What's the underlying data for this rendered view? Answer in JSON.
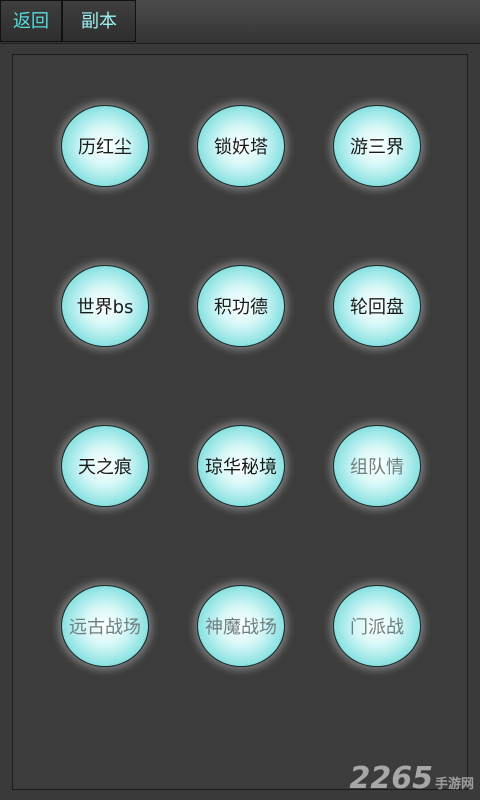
{
  "topbar": {
    "back_label": "返回",
    "dungeon_label": "副本"
  },
  "buttons": [
    {
      "label": "历红尘",
      "enabled": true
    },
    {
      "label": "锁妖塔",
      "enabled": true
    },
    {
      "label": "游三界",
      "enabled": true
    },
    {
      "label": "世界bs",
      "enabled": true
    },
    {
      "label": "积功德",
      "enabled": true
    },
    {
      "label": "轮回盘",
      "enabled": true
    },
    {
      "label": "天之痕",
      "enabled": true
    },
    {
      "label": "琼华秘境",
      "enabled": true
    },
    {
      "label": "组队情",
      "enabled": false
    },
    {
      "label": "远古战场",
      "enabled": false
    },
    {
      "label": "神魔战场",
      "enabled": false
    },
    {
      "label": "门派战",
      "enabled": false
    }
  ],
  "watermark": {
    "brand": "2265",
    "suffix": "手游网"
  },
  "colors": {
    "accent": "#55dddd",
    "button_edge": "#39c4c4",
    "background": "#3a3a3a"
  }
}
